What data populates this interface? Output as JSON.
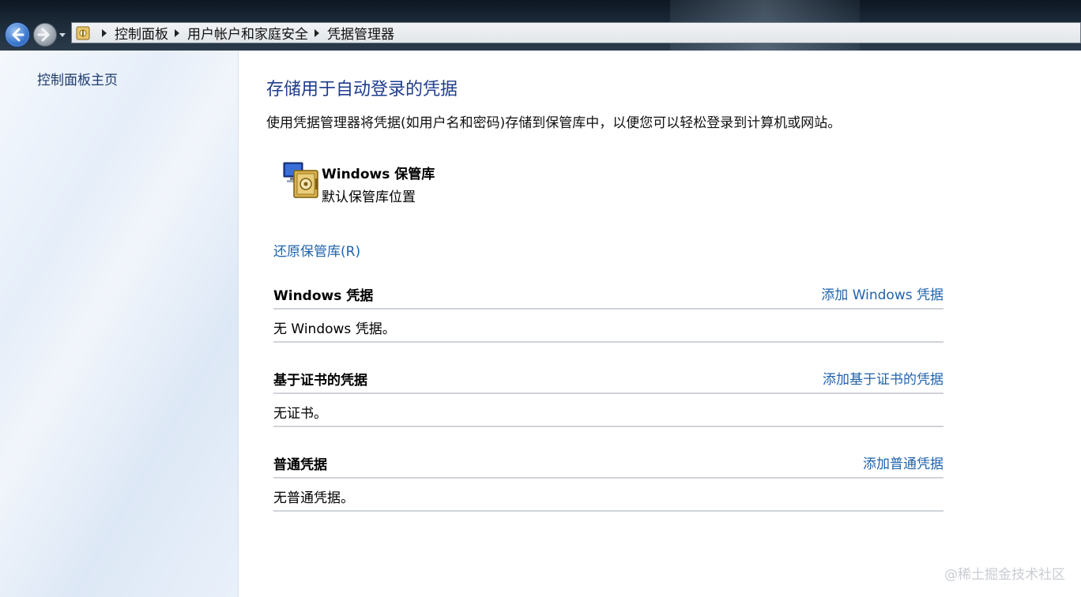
{
  "address_bar": {
    "breadcrumbs": [
      "控制面板",
      "用户帐户和家庭安全",
      "凭据管理器"
    ]
  },
  "left_pane": {
    "home_link": "控制面板主页"
  },
  "main": {
    "title": "存储用于自动登录的凭据",
    "description": "使用凭据管理器将凭据(如用户名和密码)存储到保管库中，以便您可以轻松登录到计算机或网站。",
    "vault": {
      "name": "Windows 保管库",
      "location": "默认保管库位置",
      "icon": "vault-icon"
    },
    "restore_link": "还原保管库(R)",
    "sections": [
      {
        "title": "Windows 凭据",
        "add_link": "添加 Windows 凭据",
        "empty_text": "无 Windows 凭据。"
      },
      {
        "title": "基于证书的凭据",
        "add_link": "添加基于证书的凭据",
        "empty_text": "无证书。"
      },
      {
        "title": "普通凭据",
        "add_link": "添加普通凭据",
        "empty_text": "无普通凭据。"
      }
    ]
  },
  "watermark": "@稀土掘金技术社区",
  "colors": {
    "link": "#1f63ad",
    "title": "#1e3c8c",
    "left_pane_bg": "#e6eef9"
  }
}
